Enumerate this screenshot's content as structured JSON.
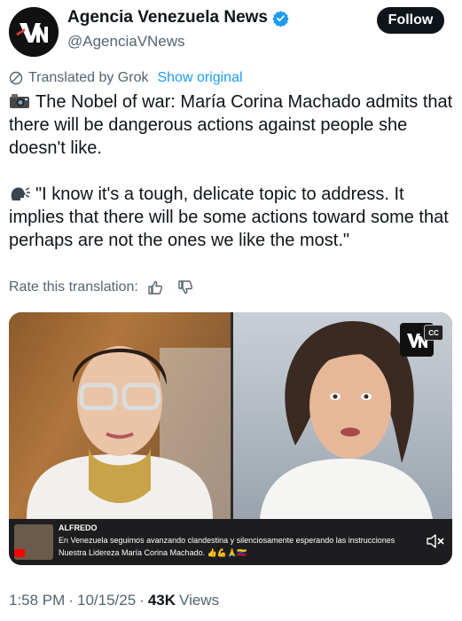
{
  "account": {
    "display_name": "Agencia Venezuela News",
    "handle": "@AgenciaVNews",
    "follow_label": "Follow",
    "avatar_text": "VN",
    "verified": true
  },
  "translation": {
    "note": "Translated by Grok",
    "show_original": "Show original",
    "rate_label": "Rate this translation:"
  },
  "tweet": {
    "paragraph1": "The Nobel of war: María Corina Machado admits that there will be dangerous actions against people she doesn't like.",
    "paragraph2": "\"I know it's a tough, delicate topic to address. It implies that there will be some actions toward some that perhaps are not the ones we like the most.\"",
    "emoji1": "camera-emoji",
    "emoji2": "speaking-head-emoji"
  },
  "media": {
    "cc_label": "CC",
    "caption_name": "ALFREDO",
    "caption_line1": "En Venezuela seguimos avanzando clandestina y silenciosamente esperando las instrucciones",
    "caption_line2": "Nuestra Lidereza María Corina Machado. 👍💪🙏🇻🇪"
  },
  "meta": {
    "time": "1:58 PM",
    "date": "10/15/25",
    "views_count": "43K",
    "views_label": "Views",
    "separator": "·"
  },
  "colors": {
    "accent": "#1d9bf0",
    "text": "#0f1419",
    "secondary": "#536471"
  }
}
